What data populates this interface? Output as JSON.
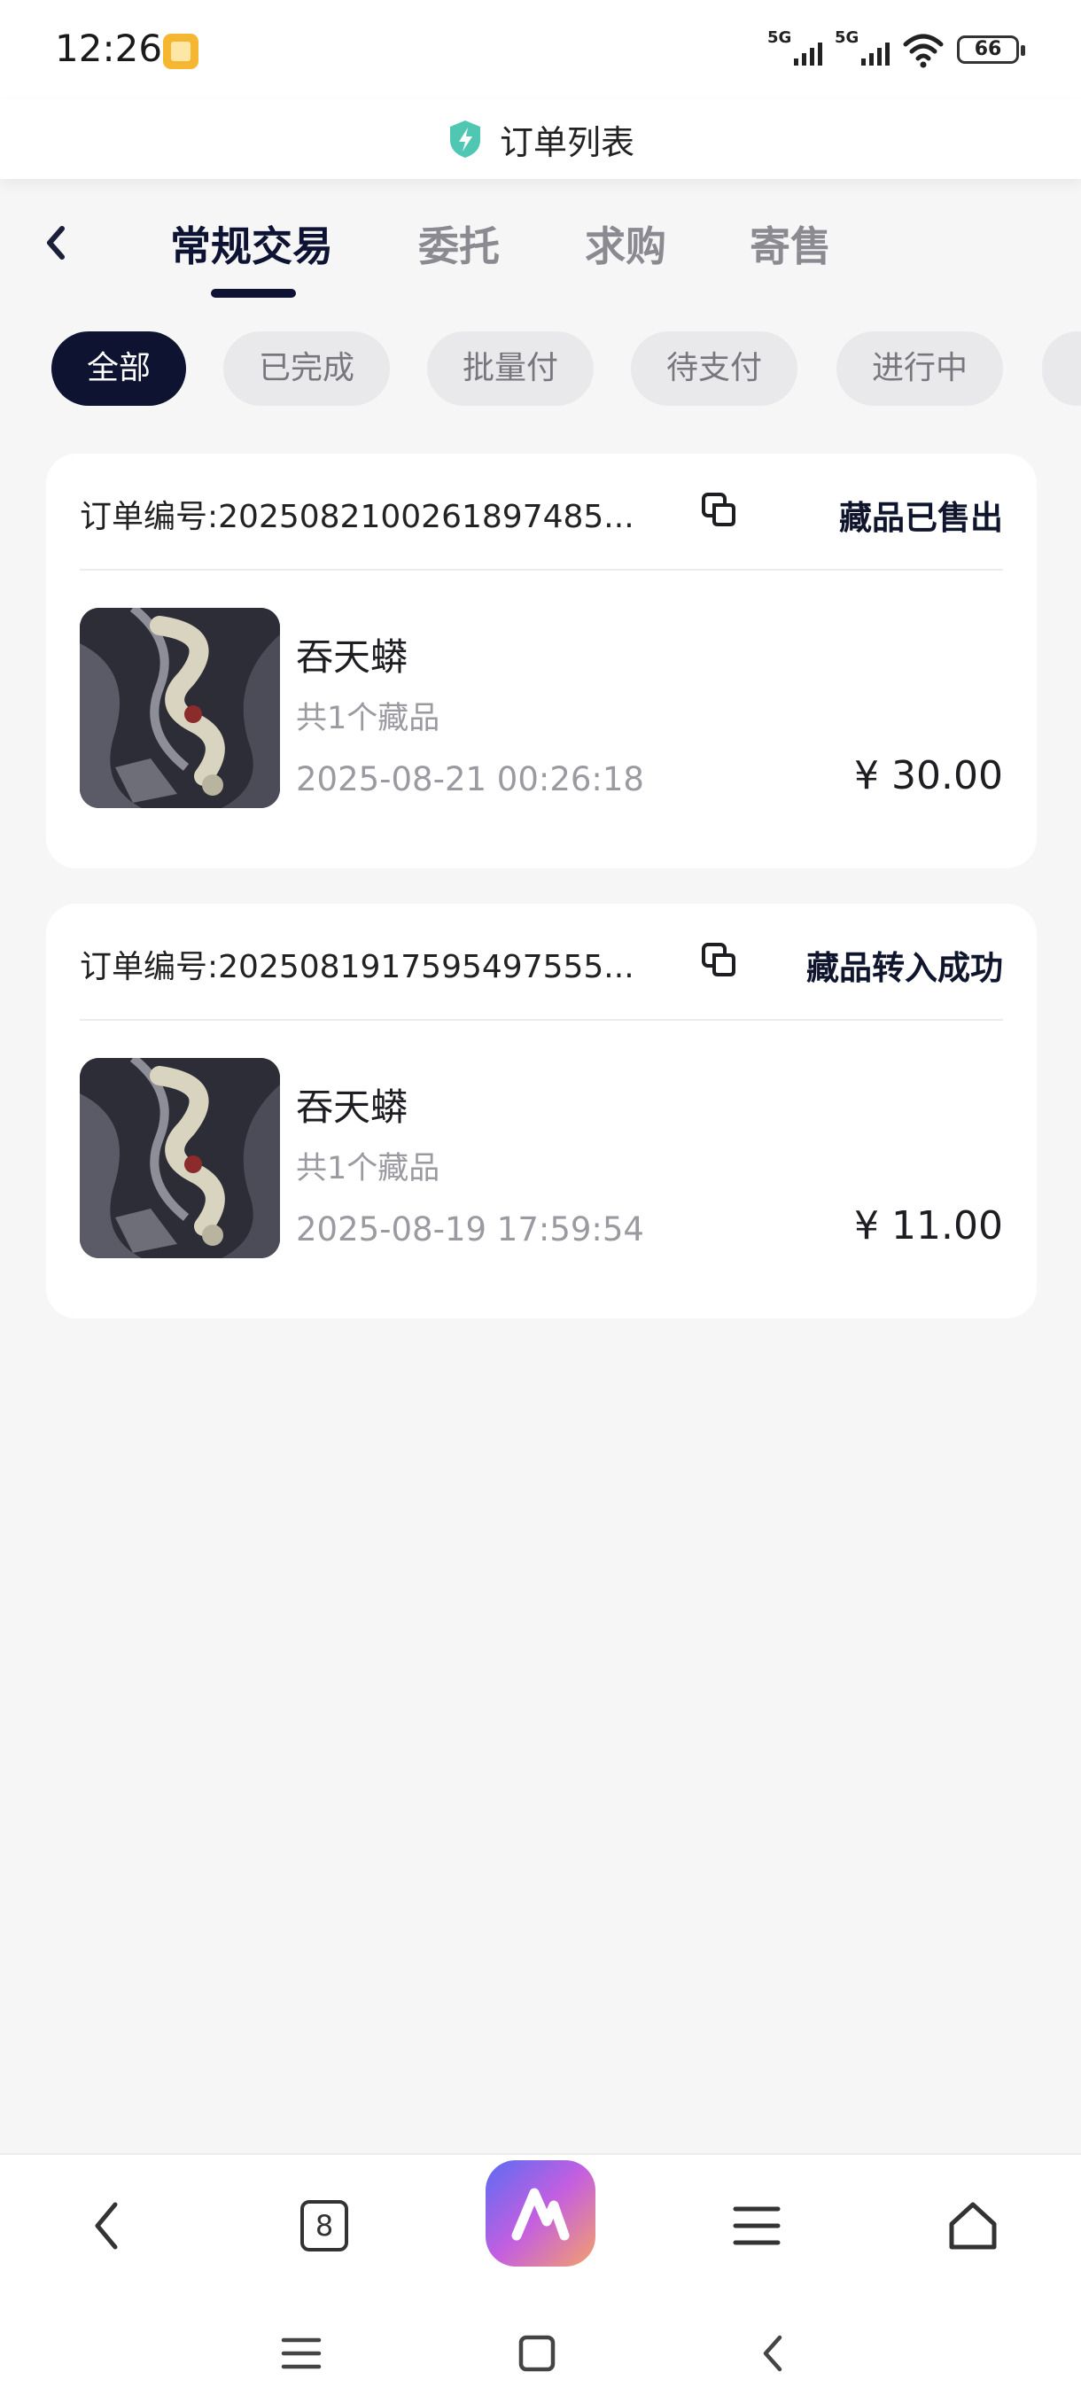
{
  "status_bar": {
    "time": "12:26",
    "signal1_label": "5G",
    "signal2_label": "5G",
    "battery": "66"
  },
  "header": {
    "title": "订单列表"
  },
  "tabs": [
    {
      "label": "常规交易",
      "active": true
    },
    {
      "label": "委托",
      "active": false
    },
    {
      "label": "求购",
      "active": false
    },
    {
      "label": "寄售",
      "active": false
    }
  ],
  "filters": [
    {
      "label": "全部",
      "active": true
    },
    {
      "label": "已完成",
      "active": false
    },
    {
      "label": "批量付",
      "active": false
    },
    {
      "label": "待支付",
      "active": false
    },
    {
      "label": "进行中",
      "active": false
    }
  ],
  "orders": [
    {
      "order_no": "订单编号:2025082100261897485...",
      "status": "藏品已售出",
      "name": "吞天蟒",
      "count": "共1个藏品",
      "time": "2025-08-21 00:26:18",
      "price": "¥ 30.00"
    },
    {
      "order_no": "订单编号:2025081917595497555...",
      "status": "藏品转入成功",
      "name": "吞天蟒",
      "count": "共1个藏品",
      "time": "2025-08-19 17:59:54",
      "price": "¥ 11.00"
    }
  ],
  "browser_toolbar": {
    "tab_count": "8",
    "icons": [
      "back-icon",
      "tabs-icon",
      "app-logo-icon",
      "menu-icon",
      "home-icon"
    ]
  },
  "system_nav": {
    "icons": [
      "recents-icon",
      "home-square-icon",
      "back-chevron-icon"
    ]
  },
  "colors": {
    "accent": "#0d1330",
    "chip_bg": "#e9e9ec",
    "page_bg": "#f6f6f7"
  }
}
